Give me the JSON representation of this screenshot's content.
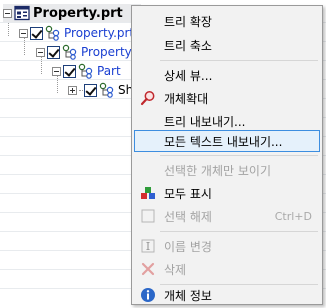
{
  "tree": {
    "root_label": "Property.prt",
    "nodes": [
      {
        "label": "Property.prt"
      },
      {
        "label": "Property"
      },
      {
        "label": "Part"
      },
      {
        "label": "Shel"
      }
    ]
  },
  "menu": {
    "items": [
      {
        "label": "트리 확장",
        "enabled": true
      },
      {
        "label": "트리 축소",
        "enabled": true
      },
      {
        "label": "상세 뷰...",
        "enabled": true
      },
      {
        "label": "개체확대",
        "enabled": true,
        "icon": "magnifier-icon"
      },
      {
        "label": "트리 내보내기...",
        "enabled": true
      },
      {
        "label": "모든 텍스트 내보내기...",
        "enabled": true,
        "highlighted": true
      },
      {
        "label": "선택한 개체만 보이기",
        "enabled": false
      },
      {
        "label": "모두 표시",
        "enabled": true,
        "icon": "show-all-icon"
      },
      {
        "label": "선택 해제",
        "enabled": false,
        "shortcut": "Ctrl+D",
        "icon": "deselect-icon"
      },
      {
        "label": "이름 변경",
        "enabled": false,
        "icon": "rename-icon"
      },
      {
        "label": "삭제",
        "enabled": false,
        "icon": "delete-icon"
      },
      {
        "label": "개체 정보",
        "enabled": true,
        "icon": "info-icon"
      }
    ]
  },
  "colors": {
    "highlight_bg": "#e5f1fb",
    "highlight_border": "#3d8ee0",
    "node_text": "#1a3fd1",
    "disabled_text": "#a3a3a3"
  }
}
